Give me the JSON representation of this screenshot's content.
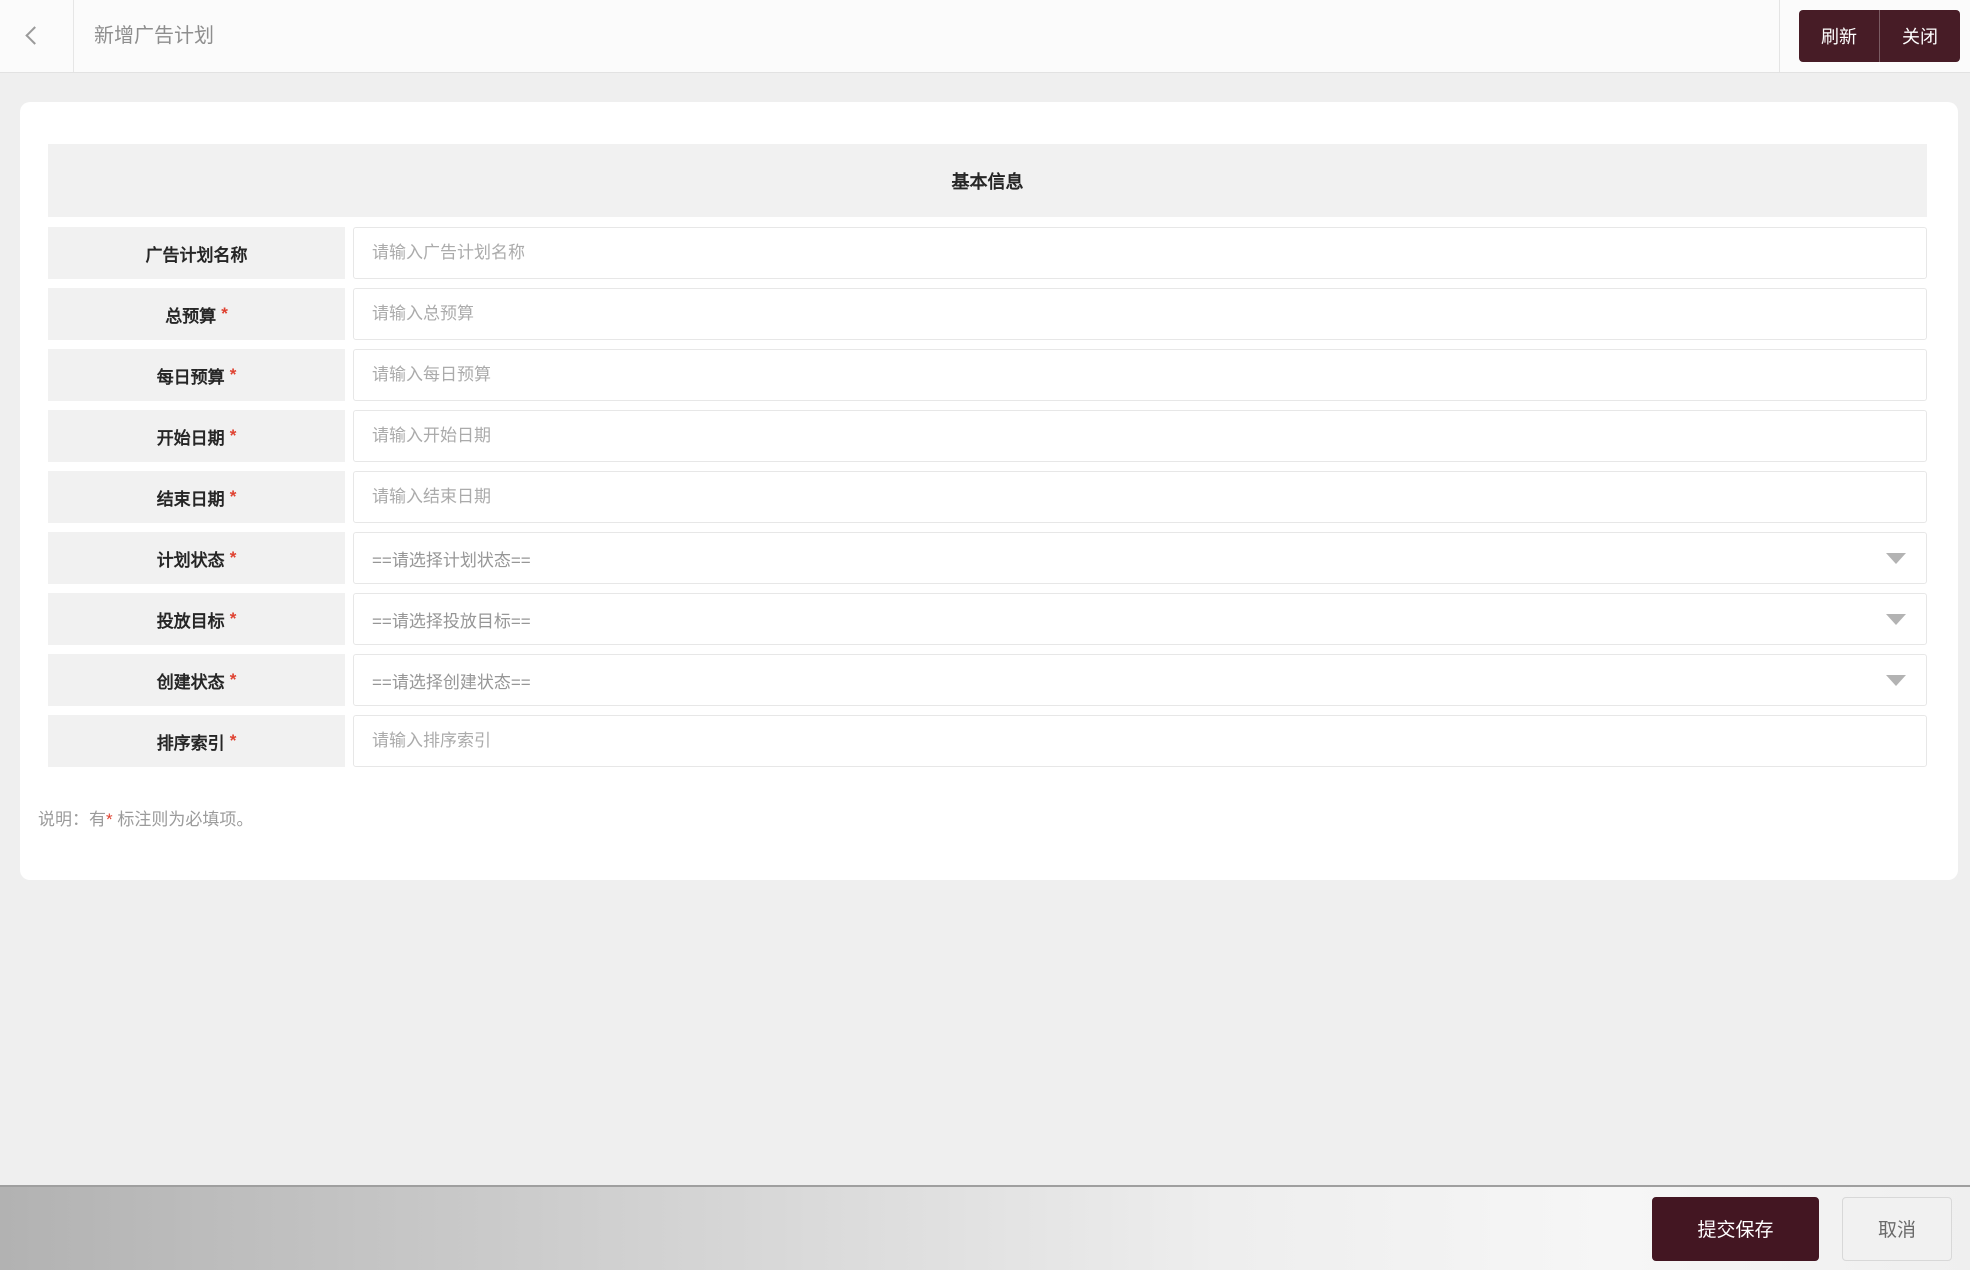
{
  "header": {
    "title": "新增广告计划",
    "back_icon": "chevron-left",
    "refresh_label": "刷新",
    "close_label": "关闭"
  },
  "form": {
    "section_title": "基本信息",
    "required_mark": "*",
    "rows": [
      {
        "label": "广告计划名称",
        "required": false,
        "type": "input",
        "placeholder": "请输入广告计划名称"
      },
      {
        "label": "总预算",
        "required": true,
        "type": "input",
        "placeholder": "请输入总预算"
      },
      {
        "label": "每日预算",
        "required": true,
        "type": "input",
        "placeholder": "请输入每日预算"
      },
      {
        "label": "开始日期",
        "required": true,
        "type": "input",
        "placeholder": "请输入开始日期"
      },
      {
        "label": "结束日期",
        "required": true,
        "type": "input",
        "placeholder": "请输入结束日期"
      },
      {
        "label": "计划状态",
        "required": true,
        "type": "select",
        "value": "==请选择计划状态=="
      },
      {
        "label": "投放目标",
        "required": true,
        "type": "select",
        "value": "==请选择投放目标=="
      },
      {
        "label": "创建状态",
        "required": true,
        "type": "select",
        "value": "==请选择创建状态=="
      },
      {
        "label": "排序索引",
        "required": true,
        "type": "input",
        "placeholder": "请输入排序索引"
      }
    ],
    "note": {
      "prefix": "说明：有",
      "star": "*",
      "suffix": " 标注则为必填项。"
    }
  },
  "footer": {
    "submit_label": "提交保存",
    "cancel_label": "取消"
  },
  "colors": {
    "brand_dark": "#471c26",
    "submit_button": "#431622",
    "required_star": "#df4130",
    "page_background": "#efefef",
    "cell_background": "#f1f1f1"
  }
}
